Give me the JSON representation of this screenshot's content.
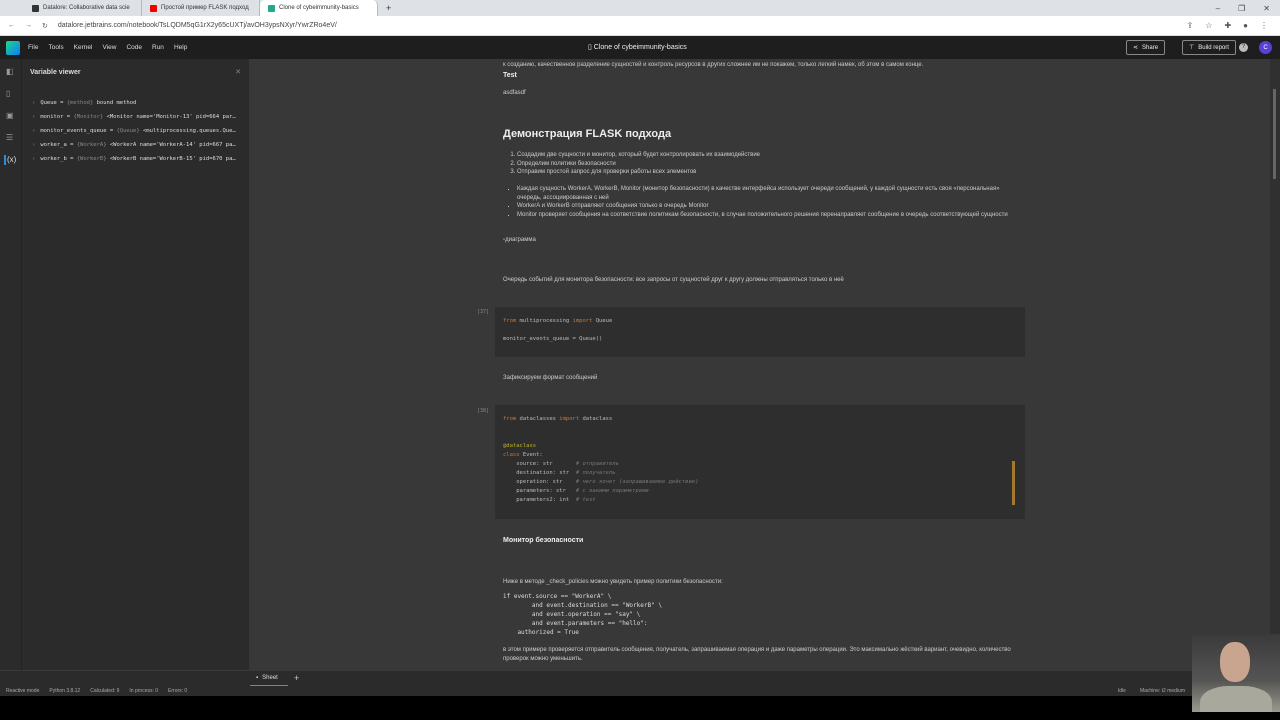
{
  "browser": {
    "tabs": [
      {
        "title": "Datalore: Collaborative data scie"
      },
      {
        "title": "Простой пример FLASK подход"
      },
      {
        "title": "Clone of cybeimmunity-basics"
      }
    ],
    "url": "datalore.jetbrains.com/notebook/TsLQDM5qG1rX2y65cUXTj/avOH3ypsNXyr/YwrZRo4eV/"
  },
  "app": {
    "menu": [
      "File",
      "Tools",
      "Kernel",
      "View",
      "Code",
      "Run",
      "Help"
    ],
    "notebook_title": "Clone of cybeimmunity-basics",
    "share": "Share",
    "build_report": "Build report",
    "help": "?",
    "avatar": "C"
  },
  "variable_viewer": {
    "title": "Variable viewer",
    "vars": [
      {
        "name": "Queue",
        "type": "{method}",
        "value": "bound method"
      },
      {
        "name": "monitor",
        "type": "{Monitor}",
        "value": "<Monitor name='Monitor-13' pid=664 par…"
      },
      {
        "name": "monitor_events_queue",
        "type": "{Queue}",
        "value": "<multiprocessing.queues.Que…"
      },
      {
        "name": "worker_a",
        "type": "{WorkerA}",
        "value": "<WorkerA name='WorkerA-14' pid=667 pa…"
      },
      {
        "name": "worker_b",
        "type": "{WorkerB}",
        "value": "<WorkerB name='WorkerB-15' pid=670 pa…"
      }
    ]
  },
  "notebook": {
    "cut_text": "к созданию, качественное разделение сущностей и контроль ресурсов в других сложнее им не покажем, только легкий намек, об этом в самом конце.",
    "test_heading": "Test",
    "test_text": "asdfasdf",
    "flask_heading": "Демонстрация FLASK подхода",
    "ol": [
      "Создадим две сущности и монитор, который будет контролировать их взаимодействие",
      "Определим политики безопасности",
      "Отправим простой запрос для проверки работы всех элементов"
    ],
    "ul": [
      "Каждая сущность WorkerA, WorkerB, Monitor (монитор безопасности) в качестве интерфейса использует очереди сообщений, у каждой сущности есть своя «персональная» очередь, ассоциированная с ней",
      "WorkerA и WorkerB отправляют сообщения только в очередь Monitor",
      "Monitor проверяет сообщения на соответствие политикам безопасности, в случае положительного решения перенаправляет сообщение в очередь соответствующей сущности"
    ],
    "img_alt": "диаграмма",
    "queue_text": "Очередь событий для монитора безопасности: все запросы от сущностей друг к другу должны отправляться только в неё",
    "cell1_num": "[37]",
    "cell1": {
      "l1_kw1": "from",
      "l1_mod": " multiprocessing ",
      "l1_kw2": "import",
      "l1_name": " Queue",
      "l2": "monitor_events_queue = Queue()"
    },
    "format_text": "Зафиксируем формат сообщений",
    "cell2_num": "[38]",
    "cell2": {
      "from": "from",
      "mod": " dataclasses ",
      "import": "import",
      "name": " dataclass",
      "decorator": "@dataclass",
      "class_kw": "class",
      "class_name": " Event:",
      "fields": [
        {
          "code": "    source: str       ",
          "comment": "# отправитель"
        },
        {
          "code": "    destination: str  ",
          "comment": "# получатель"
        },
        {
          "code": "    operation: str    ",
          "comment": "# чего хочет (запрашиваемое действие)"
        },
        {
          "code": "    parameters: str   ",
          "comment": "# с какими параметрами"
        },
        {
          "code": "    parameters2: int  ",
          "comment": "# test"
        }
      ]
    },
    "monitor_heading": "Монитор безопасности",
    "policy_intro": "Ниже в методе _check_policies можно увидеть пример политики безопасности:",
    "policy_code": "if event.source == \"WorkerA\" \\\n        and event.destination == \"WorkerB\" \\\n        and event.operation == \"say\" \\\n        and event.parameters == \"hello\":\n    authorized = True",
    "policy_note": "в этом примере проверяется отправитель сообщения, получатель, запрашиваемая операция и даже параметры операции. Это максимально жёсткий вариант, очевидно, количество проверок можно уменьшить."
  },
  "bottom": {
    "sheet_tab": "Sheet",
    "add": "+"
  },
  "status": {
    "mode": "Reactive mode",
    "python": "Python 3.8.12",
    "calculated": "Calculated: 9",
    "in_process": "In process: 0",
    "errors": "Errors: 0",
    "idle": "Idle",
    "machine": "Machine: t2 medium"
  }
}
